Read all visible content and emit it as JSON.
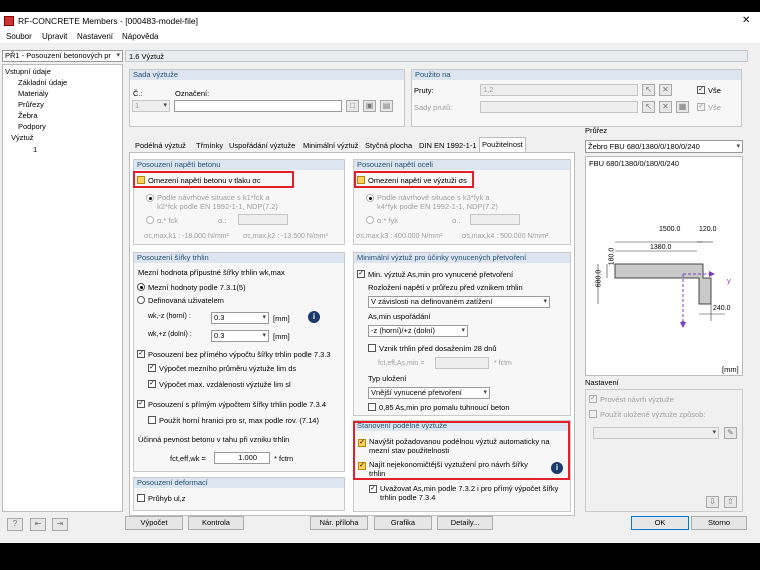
{
  "window": {
    "title": "RF-CONCRETE Members - [000483-model-file]",
    "close": "✕"
  },
  "menu": [
    "Soubor",
    "Upravit",
    "Nastavení",
    "Nápověda"
  ],
  "case_select": "PŘ1 - Posouzení betonových pr",
  "section_title": "1.6 Výztuž",
  "tree": {
    "root": "Vstupní údaje",
    "items": [
      "Základní údaje",
      "Materiály",
      "Průřezy",
      "Žebra",
      "Podpory",
      "Výztuž",
      "1"
    ]
  },
  "sada": {
    "title": "Sada výztuže",
    "no_label": "Č.:",
    "no_value": "1",
    "name_label": "Označení:"
  },
  "pouzito": {
    "title": "Použito na",
    "pruty_label": "Pruty:",
    "pruty_value": "1,2",
    "sady_label": "Sady prutů:",
    "vse": "Vše"
  },
  "tabs": [
    "Podélná výztuž",
    "Třmínky",
    "Uspořádání výztuže",
    "Minimální výztuž",
    "Styčná plocha",
    "DIN EN 1992-1-1",
    "Použitelnost"
  ],
  "napeti_beton": {
    "title": "Posouzení napětí betonu",
    "check": "Omezení napětí betonu v tlaku σc",
    "r1a": "Podle návrhové situace s k1*fck a",
    "r1b": "k2*fck podle EN 1992-1-1, NDP(7.2)",
    "r2": "α.* fck",
    "alpha": "α.:",
    "v1": "σc,max,k1 : -18.000 N/mm²",
    "v2": "σc,max,k2 : -13.500 N/mm²"
  },
  "napeti_ocel": {
    "title": "Posouzení napětí oceli",
    "check": "Omezení napětí ve výztuži σs",
    "r1a": "Podle návrhové situace s k3*fyk a",
    "r1b": "k4*fyk podle EN 1992-1-1, NDP(7.2)",
    "r2": "α.* fyk",
    "alpha": "α.:",
    "v1": "σs,max,k3 : 400.000 N/mm²",
    "v2": "σs,max,k4 : 500.000 N/mm²"
  },
  "trhliny": {
    "title": "Posouzení šířky trhlin",
    "mezni": "Mezní hodnota přípustné šířky trhlin wk,max",
    "r1": "Mezní hodnoty podle 7.3.1(5)",
    "r2": "Definovaná uživatelem",
    "wkh": "wk,-z (horní) :",
    "wkh_v": "0.3",
    "wkd": "wk,+z (dolní) :",
    "wkd_v": "0.3",
    "unit": "[mm]",
    "c1": "Posouzení bez přímého výpočtu šířky trhlin podle 7.3.3",
    "c1a": "Výpočet mezního průměru výztuže lim ds",
    "c1b": "Výpočet max. vzdálenosti výztuže lim sl",
    "c2": "Posouzení s přímým výpočtem šířky trhlin podle 7.3.4",
    "c2a": "Použít horní hranici pro sr, max podle rov. (7.14)",
    "ucinna": "Účinná pevnost betonu v tahu při vzniku trhlin",
    "fct": "fct,eff,wk =",
    "fct_v": "1.000",
    "fct_u": "* fctm"
  },
  "deformace": {
    "title": "Posouzení deformací",
    "check": "Průhyb ul,z"
  },
  "minvyz": {
    "title": "Minimální výztuž pro účinky vynucených přetvoření",
    "check": "Min. výztuž As,min pro vynucené přetvoření",
    "rozloz": "Rozložení napětí v průřezu před vznikem trhlin",
    "rozloz_v": "V závislosti na definovaném zatížení",
    "usp": "As,min uspořádání",
    "usp_v": "-z (horní)/+z (dolní)",
    "vznik": "Vznik trhlin před dosažením 28 dnů",
    "fct": "fct,eff,As,min =",
    "fct_u": "* fctm",
    "typ": "Typ uložení",
    "typ_v": "Vnější vynucené přetvoření",
    "c085": "0,85 As,min pro pomalu tuhnoucí beton"
  },
  "stanoveni": {
    "title": "Stanovení podélné výztuže",
    "c1": "Navýšit požadovanou podélnou výztuž automaticky na mezní stav použitelnosti",
    "c2": "Najít nejekonomičtější vyztužení pro návrh šířky trhlin",
    "c3": "Uvažovat As,min podle 7.3.2 i pro přímý výpočet šířky trhlin podle 7.3.4"
  },
  "prurez": {
    "title": "Průřez",
    "sel": "Žebro FBU 680/1380/0/180/0/240",
    "name": "FBU 680/1380/0/180/0/240",
    "d1500": "1500.0",
    "d1380": "1380.0",
    "d120": "120.0",
    "d180": "180.0",
    "d680": "680.0",
    "d240": "240.0",
    "y": "y",
    "z": "z",
    "unit": "[mm]"
  },
  "nastaveni": {
    "title": "Nastavení",
    "c1": "Provést návrh výztuže",
    "c2": "Použít uložené výztuže způsob:"
  },
  "buttons": {
    "vypocet": "Výpočet",
    "kontrola": "Kontrola",
    "nar": "Nár. příloha",
    "grafika": "Grafika",
    "detaily": "Detaily...",
    "ok": "OK",
    "storno": "Storno"
  },
  "accent": "#0078d7",
  "highlight": "#e0202a"
}
